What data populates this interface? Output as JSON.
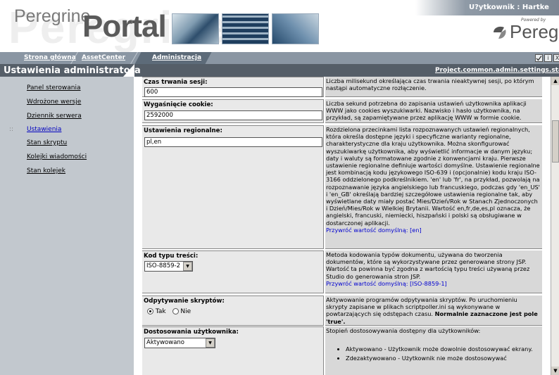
{
  "header": {
    "logo_ghost": "Peregrine",
    "logo_peregrine": "Peregrine",
    "logo_portal": "Portal",
    "user_label": "U?ytkownik : Hartke",
    "brand_small": "Powered by",
    "brand_name": "Peregrine"
  },
  "tabs": [
    {
      "label": "Strona główna"
    },
    {
      "label": "AssetCenter"
    },
    {
      "label": "Administracja"
    }
  ],
  "toolbar": {
    "check_icon": "checkmark-icon",
    "info_icon": "info-icon",
    "close_icon": "close-icon",
    "info_glyph": "i",
    "close_glyph": "X"
  },
  "page_title": "Ustawienia administratora",
  "title_link": "Project.common.admin.settings.start",
  "sidebar": {
    "items": [
      {
        "label": "Panel sterowania"
      },
      {
        "label": "Wdrożone wersje"
      },
      {
        "label": "Dziennik serwera"
      },
      {
        "label": "Ustawienia",
        "active": true
      },
      {
        "label": "Stan skryptu"
      },
      {
        "label": "Kolejki wiadomości"
      },
      {
        "label": "Stan kolejek"
      }
    ],
    "bullet": "::"
  },
  "settings": [
    {
      "label": "Czas trwania sesji:",
      "value": "600",
      "description": "Liczba milisekund określająca czas trwania nieaktywnej sesji, po którym nastąpi automatyczne rozłączenie."
    },
    {
      "label": "Wygaśnięcie cookie:",
      "value": "2592000",
      "description": "Liczba sekund potrzebna do zapisania ustawień użytkownika aplikacji WWW jako cookies wyszukiwarki. Nazwisko i hasło użytkownika, na przykład, są zapamiętywane przez aplikację WWW w formie cookie."
    },
    {
      "label": "Ustawienia regionalne:",
      "value": "pl,en",
      "description": "Rozdzielona przecinkami lista rozpoznawanych ustawień regionalnych, która określa dostępne języki i specyficzne warianty regionalne, charakterystyczne dla kraju użytkownika. Można skonfigurować wyszukiwarkę użytkownika, aby wyświetlić informacje w danym języku; daty i waluty są formatowane zgodnie z konwencjami kraju. Pierwsze ustawienie regionalne definiuje wartości domyślne. Ustawienie regionalne jest kombinacją kodu językowego ISO-639 i (opcjonalnie) kodu kraju ISO-3166 oddzielonego podkreślnikiem. 'en' lub 'fr', na przykład, pozwolają na rozpoznawanie języka angielskiego lub francuskiego, podczas gdy 'en_US' i 'en_GB' określają bardziej szczegółowe ustawienia regionalne tak, aby wyświetlane daty miały postać Mies/Dzień/Rok w Stanach Zjednoczonych i Dzień/Mies/Rok w Wielkiej Brytanii. Wartość en,fr,de,es,pl oznacza, że angielski, francuski, niemiecki, hiszpański i polski są obsługiwane w dostarczonej aplikacji.",
      "restore": "Przywróć wartość domyślną: [en]"
    },
    {
      "label": "Kod typu treści:",
      "value": "ISO-8859-2",
      "description": "Metoda kodowania typów dokumentu, używana do tworzenia dokumentów, które są wykorzystywane przez generowane strony JSP. Wartość ta powinna być zgodna z wartością typu treści używaną przez Studio do generowania stron JSP.",
      "restore": "Przywróć wartość domyślną: [ISO-8859-1]"
    },
    {
      "label": "Odpytywanie skryptów:",
      "option_yes": "Tak",
      "option_no": "Nie",
      "selected": "Tak",
      "description": "Aktywowanie programów odpytywania skryptów. Po uruchomieniu skrypty zapisane w plikach scriptpoller.ini są wykonywane w powtarzających się odstępach czasu.",
      "description_bold": "Normalnie zaznaczone jest pole 'true'."
    },
    {
      "label": "Dostosowania użytkownika:",
      "value": "Aktywowano",
      "description": "Stopień dostosowywania dostępny dla użytkowników:",
      "bullets": [
        "Aktywowano - Użytkownik może dowolnie dostosowywać ekrany.",
        "Zdezaktywowano - Użytkownik nie może dostosowywać"
      ]
    }
  ],
  "colors": {
    "tabbar": "#8a96a3",
    "titlebar": "#555e68",
    "sidebar": "#c2c8ce",
    "link": "#0000d0"
  }
}
